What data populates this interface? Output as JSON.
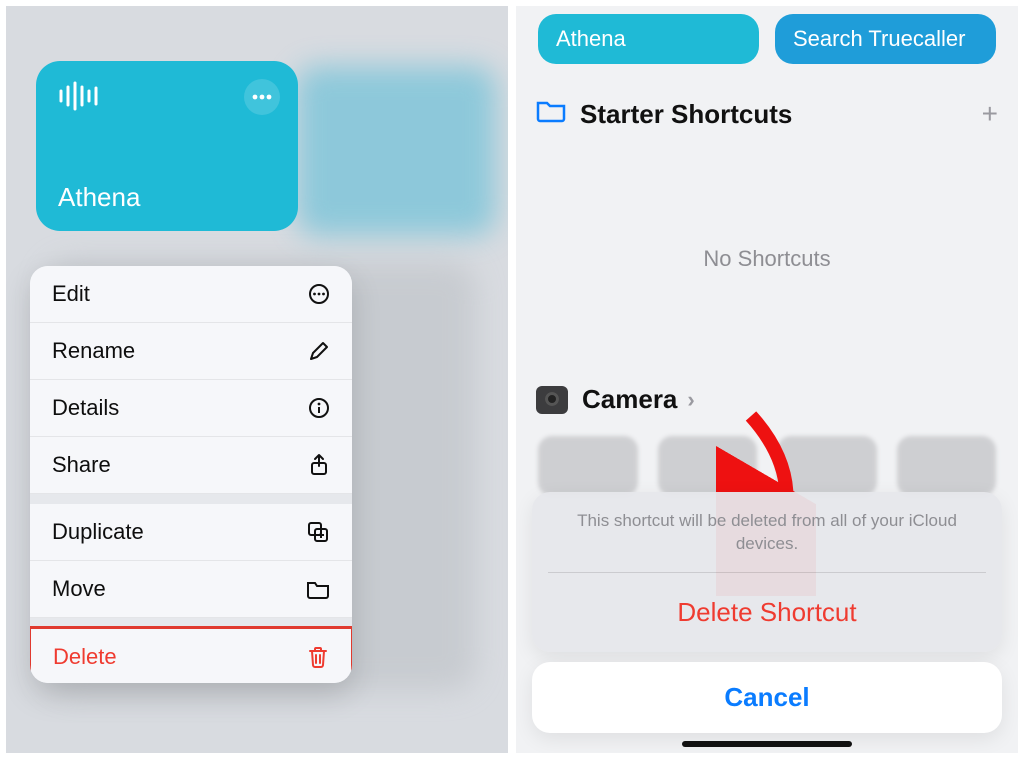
{
  "left": {
    "shortcut_card": {
      "title": "Athena"
    },
    "context_menu": {
      "edit": "Edit",
      "rename": "Rename",
      "details": "Details",
      "share": "Share",
      "duplicate": "Duplicate",
      "move": "Move",
      "delete": "Delete"
    }
  },
  "right": {
    "tiles": {
      "athena": "Athena",
      "truecaller": "Search Truecaller"
    },
    "section_title": "Starter Shortcuts",
    "empty_text": "No Shortcuts",
    "camera_label": "Camera",
    "sheet": {
      "message": "This shortcut will be deleted from all of your iCloud devices.",
      "delete": "Delete Shortcut",
      "cancel": "Cancel"
    }
  }
}
